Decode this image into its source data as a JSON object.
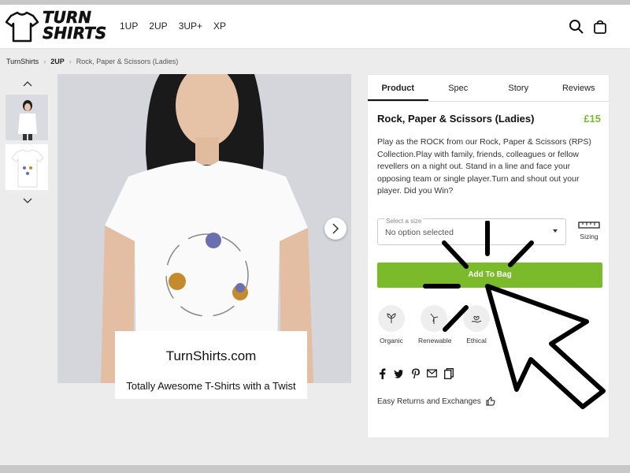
{
  "header": {
    "logo": {
      "line1": "TURN",
      "line2": "SHIRTS"
    },
    "nav": [
      "1UP",
      "2UP",
      "3UP+",
      "XP"
    ],
    "icons": {
      "search": "search-icon",
      "bag": "bag-icon"
    }
  },
  "breadcrumb": [
    "TurnShirts",
    "2UP",
    "Rock, Paper & Scissors (Ladies)"
  ],
  "gallery": {
    "caption_title": "TurnShirts.com",
    "caption_sub": "Totally Awesome T-Shirts with a Twist"
  },
  "product": {
    "tabs": [
      "Product",
      "Spec",
      "Story",
      "Reviews"
    ],
    "active_tab": "Product",
    "title": "Rock, Paper & Scissors (Ladies)",
    "price": "£15",
    "description": "Play as the ROCK from our Rock, Paper & Scissors (RPS) Collection.Play with family, friends, colleagues or fellow revellers on a night out. Stand in a line and face your opposing team or single player.Turn and shout out your player. Did you Win?",
    "size_select": {
      "label": "Select a size",
      "value": "No option selected"
    },
    "sizing_label": "Sizing",
    "add_to_bag": "Add To Bag",
    "badges": [
      "Organic",
      "Renewable",
      "Ethical"
    ],
    "returns": "Easy Returns and Exchanges"
  },
  "colors": {
    "accent_green": "#7bbb2b",
    "price_green": "#7ab830"
  }
}
